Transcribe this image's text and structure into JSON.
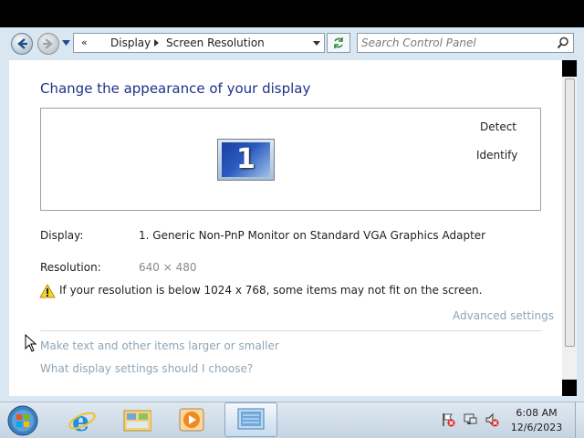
{
  "address_bar": {
    "crumbs": [
      "Display",
      "Screen Resolution"
    ]
  },
  "search": {
    "placeholder": "Search Control Panel"
  },
  "main": {
    "heading": "Change the appearance of your display",
    "monitor_number": "1",
    "detect_label": "Detect",
    "identify_label": "Identify",
    "display_label": "Display:",
    "display_value": "1. Generic Non-PnP Monitor on Standard VGA Graphics Adapter",
    "resolution_label": "Resolution:",
    "resolution_value": "640 × 480",
    "warning_text": "If your resolution is below 1024 x 768, some items may not fit on the screen.",
    "advanced_link": "Advanced settings",
    "links": [
      "Make text and other items larger or smaller",
      "What display settings should I choose?"
    ]
  },
  "taskbar": {
    "pinned": [
      "internet-explorer-icon",
      "file-explorer-icon",
      "media-player-icon",
      "control-panel-icon"
    ],
    "tray": [
      "action-center-flag-icon",
      "network-icon",
      "volume-muted-icon"
    ],
    "time": "6:08 AM",
    "date": "12/6/2023"
  },
  "colors": {
    "heading": "#1e3287",
    "link": "#8fa5b5",
    "chrome": "#d9e7f2"
  }
}
